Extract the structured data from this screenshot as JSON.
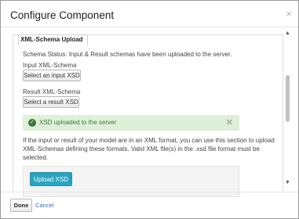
{
  "dialog": {
    "title": "Configure Component",
    "close_glyph": "×"
  },
  "panel": {
    "tab_label": "XML-Schema Upload",
    "status_text": "Schema Status: Input & Result schemas have been uploaded to the server.",
    "input_label": "Input XML-Schema",
    "input_button": "Select an input XSD",
    "result_label": "Result XML-Schema",
    "result_button": "Select a result XSD",
    "alert": {
      "message": "XSD uploaded to the server",
      "close_glyph": "✕",
      "icon": "check-circle-icon",
      "color": "#3c763d",
      "background": "#dff0d8"
    },
    "help_text": [
      "If the input or result of your model are in an XML format, you can use this section to upload",
      "XML-Schemas defining these formats. Valid XML file(s) in the .xsd file format must be",
      "selected."
    ],
    "upload_button": "Upload XSD",
    "upload_button_color": "#2aa4c0"
  },
  "scrollbar": {
    "up_glyph": "▲",
    "down_glyph": "▼"
  },
  "footer": {
    "done_label": "Done",
    "cancel_label": "Cancel"
  }
}
